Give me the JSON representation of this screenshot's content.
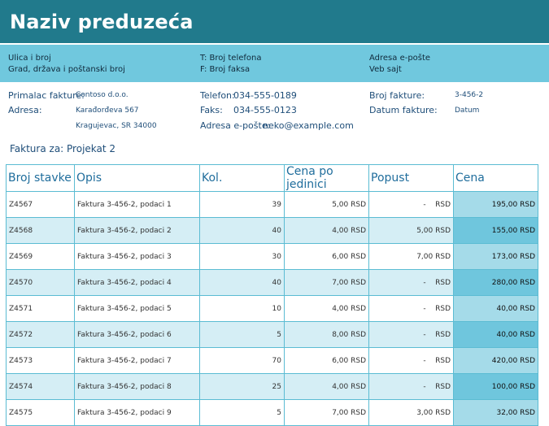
{
  "company": {
    "name": "Naziv preduzeća"
  },
  "address_band": {
    "col1": [
      "Ulica i broj",
      "Grad, država i poštanski broj"
    ],
    "col2": [
      "T: Broj telefona",
      "F: Broj faksa"
    ],
    "col3": [
      "Adresa e-pošte",
      "Veb sajt"
    ]
  },
  "recipient": {
    "label_recipient": "Primalac fakture:",
    "recipient_name": "Contoso d.o.o.",
    "label_address": "Adresa:",
    "street": "Karađorđeva 567",
    "city": "Kragujevac, SR 34000"
  },
  "contact": {
    "phone_label": "Telefon:",
    "phone": "034-555-0189",
    "fax_label": "Faks:",
    "fax": "034-555-0123",
    "email_label": "Adresa e-pošte:",
    "email": "neko@example.com"
  },
  "invoice": {
    "number_label": "Broj fakture:",
    "number": "3-456-2",
    "date_label": "Datum fakture:",
    "date": "Datum"
  },
  "for_line": "Faktura za: Projekat 2",
  "table": {
    "headers": [
      "Broj stavke",
      "Opis",
      "Kol.",
      "Cena po jedinici",
      "Popust",
      "Cena"
    ],
    "rows": [
      [
        "Z4567",
        "Faktura 3-456-2, podaci 1",
        "39",
        "5,00 RSD",
        "-    RSD",
        "195,00 RSD"
      ],
      [
        "Z4568",
        "Faktura 3-456-2, podaci 2",
        "40",
        "4,00 RSD",
        "5,00 RSD",
        "155,00 RSD"
      ],
      [
        "Z4569",
        "Faktura 3-456-2, podaci 3",
        "30",
        "6,00 RSD",
        "7,00 RSD",
        "173,00 RSD"
      ],
      [
        "Z4570",
        "Faktura 3-456-2, podaci 4",
        "40",
        "7,00 RSD",
        "-    RSD",
        "280,00 RSD"
      ],
      [
        "Z4571",
        "Faktura 3-456-2, podaci 5",
        "10",
        "4,00 RSD",
        "-    RSD",
        "40,00 RSD"
      ],
      [
        "Z4572",
        "Faktura 3-456-2, podaci 6",
        "5",
        "8,00 RSD",
        "-    RSD",
        "40,00 RSD"
      ],
      [
        "Z4573",
        "Faktura 3-456-2, podaci 7",
        "70",
        "6,00 RSD",
        "-    RSD",
        "420,00 RSD"
      ],
      [
        "Z4574",
        "Faktura 3-456-2, podaci 8",
        "25",
        "4,00 RSD",
        "-    RSD",
        "100,00 RSD"
      ],
      [
        "Z4575",
        "Faktura 3-456-2, podaci 9",
        "5",
        "7,00 RSD",
        "3,00 RSD",
        "32,00 RSD"
      ]
    ]
  },
  "colors": {
    "title_band": "#217a8c",
    "address_band": "#70c8de",
    "row_alt": "#d5eef5",
    "price_cell": "#a5dbe9",
    "price_cell_alt": "#6fc6dd"
  }
}
